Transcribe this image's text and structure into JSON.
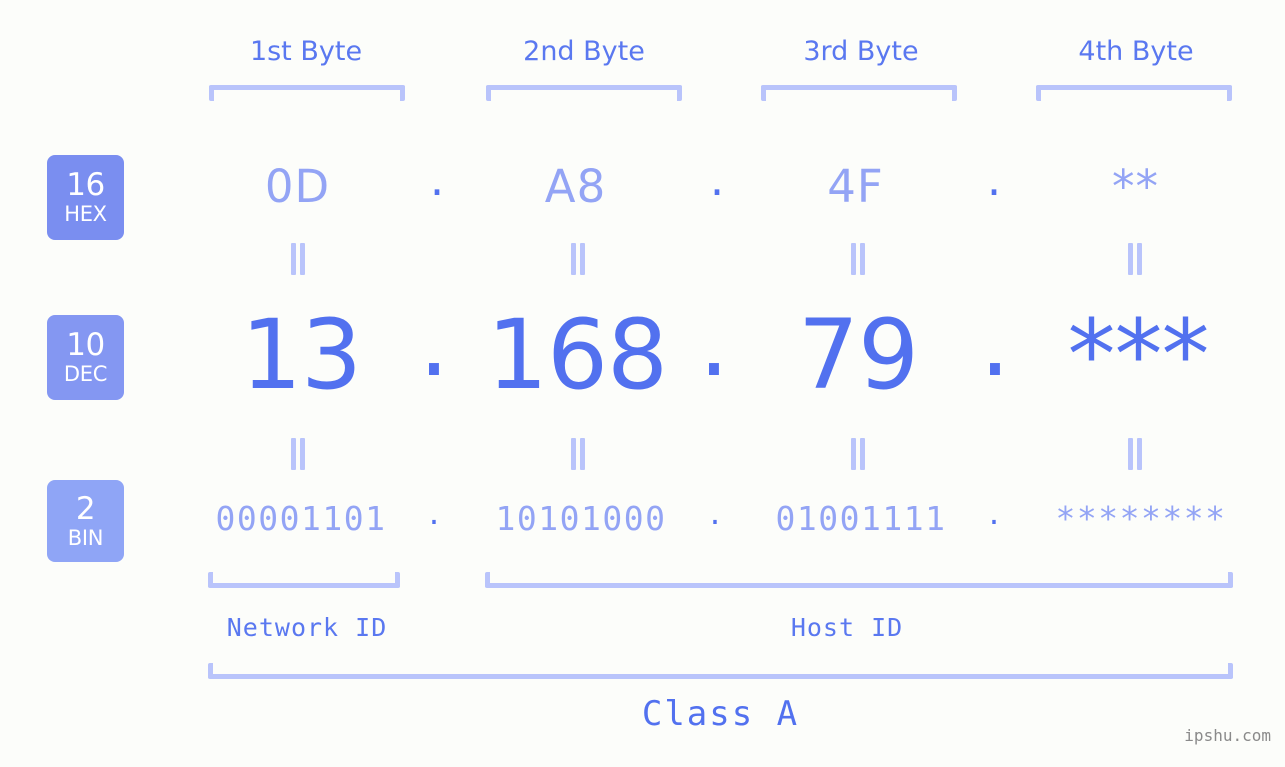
{
  "background_color": "#fcfdfa",
  "accent_colors": {
    "strong_blue": "#5271ef",
    "mid_blue": "#5a78f0",
    "light_blue": "#93a4f5",
    "bracket_blue": "#b9c4fb",
    "badge_hex": "#7a8ef0",
    "badge_dec": "#8497f2",
    "badge_bin": "#8fa5f6",
    "watermark_gray": "#8a8a8a"
  },
  "byte_headers": [
    {
      "label": "1st Byte"
    },
    {
      "label": "2nd Byte"
    },
    {
      "label": "3rd Byte"
    },
    {
      "label": "4th Byte"
    }
  ],
  "bases": [
    {
      "id": "hex",
      "number": "16",
      "name": "HEX"
    },
    {
      "id": "dec",
      "number": "10",
      "name": "DEC"
    },
    {
      "id": "bin",
      "number": "2",
      "name": "BIN"
    }
  ],
  "rows": {
    "hex": {
      "values": [
        "0D",
        "A8",
        "4F",
        "**"
      ],
      "separators": [
        ".",
        ".",
        "."
      ]
    },
    "dec": {
      "values": [
        "13",
        "168",
        "79",
        "***"
      ],
      "separators": [
        ".",
        ".",
        "."
      ]
    },
    "bin": {
      "values": [
        "00001101",
        "10101000",
        "01001111",
        "********"
      ],
      "separators": [
        ".",
        ".",
        "."
      ]
    }
  },
  "equals_marker": "‖",
  "segments": {
    "network_id": "Network ID",
    "host_id": "Host ID"
  },
  "class_label": "Class A",
  "watermark": "ipshu.com"
}
